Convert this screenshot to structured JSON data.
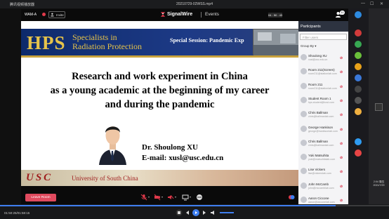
{
  "player": {
    "app_title": "腾讯视频播放器",
    "file_title": "20210729-02WSS.mp4",
    "time": "01:50:25/01:58:15"
  },
  "header": {
    "room": "WAM-A",
    "invite_label": "Invite",
    "brand": "SignalWire",
    "section": "Events",
    "timer": "04 : 50 : 43",
    "participant_count": "11"
  },
  "slide": {
    "logo_text": "HPS",
    "logo_sub": [
      "Specialists in",
      "Radiation Protection"
    ],
    "session": "Special Session: Pandemic Exp",
    "title_lines": [
      "Research and work experiment in China",
      "as a young academic at the beginning of my career",
      "and during the pandemic"
    ],
    "speaker_name": "Dr. Shoulong XU",
    "speaker_email": "E-mail: xusl@usc.edu.cn",
    "footer_abbr": "USC",
    "footer_uni": "University of South China"
  },
  "controls": {
    "leave_label": "Leave Room"
  },
  "panel": {
    "title": "Participants",
    "filter_placeholder": "Filter users",
    "group_by": "Group By",
    "people": [
      {
        "name": "Shoulong XU",
        "sub": "xusl@usc.edu.cn"
      },
      {
        "name": "Room 211(Screen)",
        "sub": "room211@stationlab.com"
      },
      {
        "name": "Room 211",
        "sub": "room211@stationlab.com"
      },
      {
        "name": "Student Room 1",
        "sub": "hps.student@host.com"
      },
      {
        "name": "Chris Ballman",
        "sub": "chris@ballmanlab.com"
      },
      {
        "name": "George Hankison",
        "sub": "george@hankisonlab.com"
      },
      {
        "name": "Chris Ballman",
        "sub": "chris@ballmanlab.com"
      },
      {
        "name": "Yuki Matsuhita",
        "sub": "yuki@matsuhitalab.com"
      },
      {
        "name": "Lise Vickers",
        "sub": "lise@vickerslab.com"
      },
      {
        "name": "John McCamb",
        "sub": "john@mccamblab.com"
      },
      {
        "name": "Aaron Ciccone",
        "sub": "aaron@cicconelab.com"
      }
    ]
  },
  "taskbar": {
    "clock": "2:04 周四",
    "date": "2021/7/29"
  },
  "colors": {
    "accent": "#3f7ff0",
    "leave": "#e04a5e",
    "banner": "#1d3a86",
    "gold": "#e6c34a",
    "usc_red": "#9e1b1b"
  },
  "progress_fraction": 0.863
}
